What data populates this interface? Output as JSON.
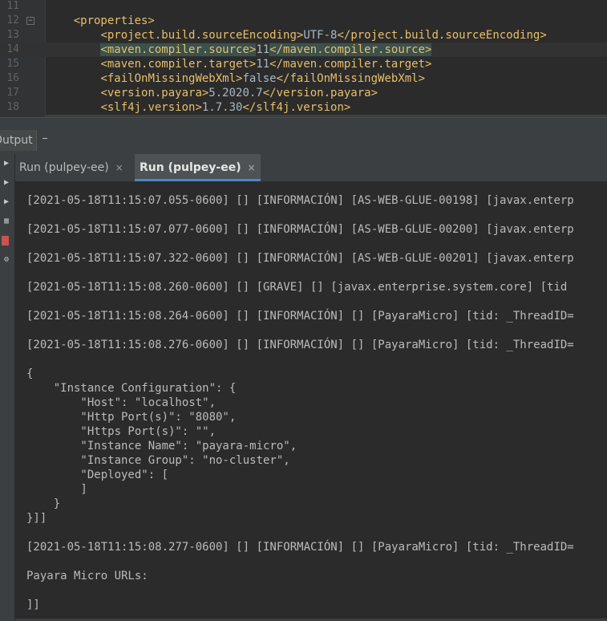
{
  "editor": {
    "lines": [
      {
        "num": "11",
        "fold": "",
        "open": "",
        "value": "",
        "close": ""
      },
      {
        "num": "12",
        "fold": "−",
        "open": "<properties>",
        "value": "",
        "close": ""
      },
      {
        "num": "13",
        "fold": "",
        "open": "<project.build.sourceEncoding>",
        "value": "UTF-8",
        "close": "</project.build.sourceEncoding>"
      },
      {
        "num": "14",
        "fold": "",
        "open": "<maven.compiler.source>",
        "value": "11",
        "close": "</maven.compiler.source>"
      },
      {
        "num": "15",
        "fold": "",
        "open": "<maven.compiler.target>",
        "value": "11",
        "close": "</maven.compiler.target>"
      },
      {
        "num": "16",
        "fold": "",
        "open": "<failOnMissingWebXml>",
        "value": "false",
        "close": "</failOnMissingWebXml>"
      },
      {
        "num": "17",
        "fold": "",
        "open": "<version.payara>",
        "value": "5.2020.7",
        "close": "</version.payara>"
      },
      {
        "num": "18",
        "fold": "",
        "open": "<slf4j.version>",
        "value": "1.7.30",
        "close": "</slf4j.version>"
      }
    ]
  },
  "output_panel": {
    "title": "Output",
    "tabs": [
      {
        "label": "Run (pulpey-ee)",
        "close": "×",
        "active": false
      },
      {
        "label": "Run (pulpey-ee)",
        "close": "×",
        "active": true
      }
    ]
  },
  "side_toolbar": {
    "icons": [
      "play-icon",
      "play-icon",
      "play-icon",
      "grid-icon",
      "stop-icon",
      "gear-icon"
    ],
    "stop_color": "#c75450"
  },
  "console": {
    "lines": [
      "[2021-05-18T11:15:07.055-0600] [] [INFORMACIÓN] [AS-WEB-GLUE-00198] [javax.enterp",
      "",
      "[2021-05-18T11:15:07.077-0600] [] [INFORMACIÓN] [AS-WEB-GLUE-00200] [javax.enterp",
      "",
      "[2021-05-18T11:15:07.322-0600] [] [INFORMACIÓN] [AS-WEB-GLUE-00201] [javax.enterp",
      "",
      "[2021-05-18T11:15:08.260-0600] [] [GRAVE] [] [javax.enterprise.system.core] [tid",
      "",
      "[2021-05-18T11:15:08.264-0600] [] [INFORMACIÓN] [] [PayaraMicro] [tid: _ThreadID=",
      "",
      "[2021-05-18T11:15:08.276-0600] [] [INFORMACIÓN] [] [PayaraMicro] [tid: _ThreadID=",
      "",
      "{",
      "    \"Instance Configuration\": {",
      "        \"Host\": \"localhost\",",
      "        \"Http Port(s)\": \"8080\",",
      "        \"Https Port(s)\": \"\",",
      "        \"Instance Name\": \"payara-micro\",",
      "        \"Instance Group\": \"no-cluster\",",
      "        \"Deployed\": [",
      "        ]",
      "    }",
      "}]]",
      "",
      "[2021-05-18T11:15:08.277-0600] [] [INFORMACIÓN] [] [PayaraMicro] [tid: _ThreadID=",
      "",
      "Payara Micro URLs:",
      "",
      "]]"
    ]
  },
  "colors": {
    "background": "#2b2b2b",
    "tag": "#e8bf6a",
    "text": "#a9b7c6",
    "console_text": "#bbbbbb",
    "active_tab_underline": "#4a88c7"
  }
}
